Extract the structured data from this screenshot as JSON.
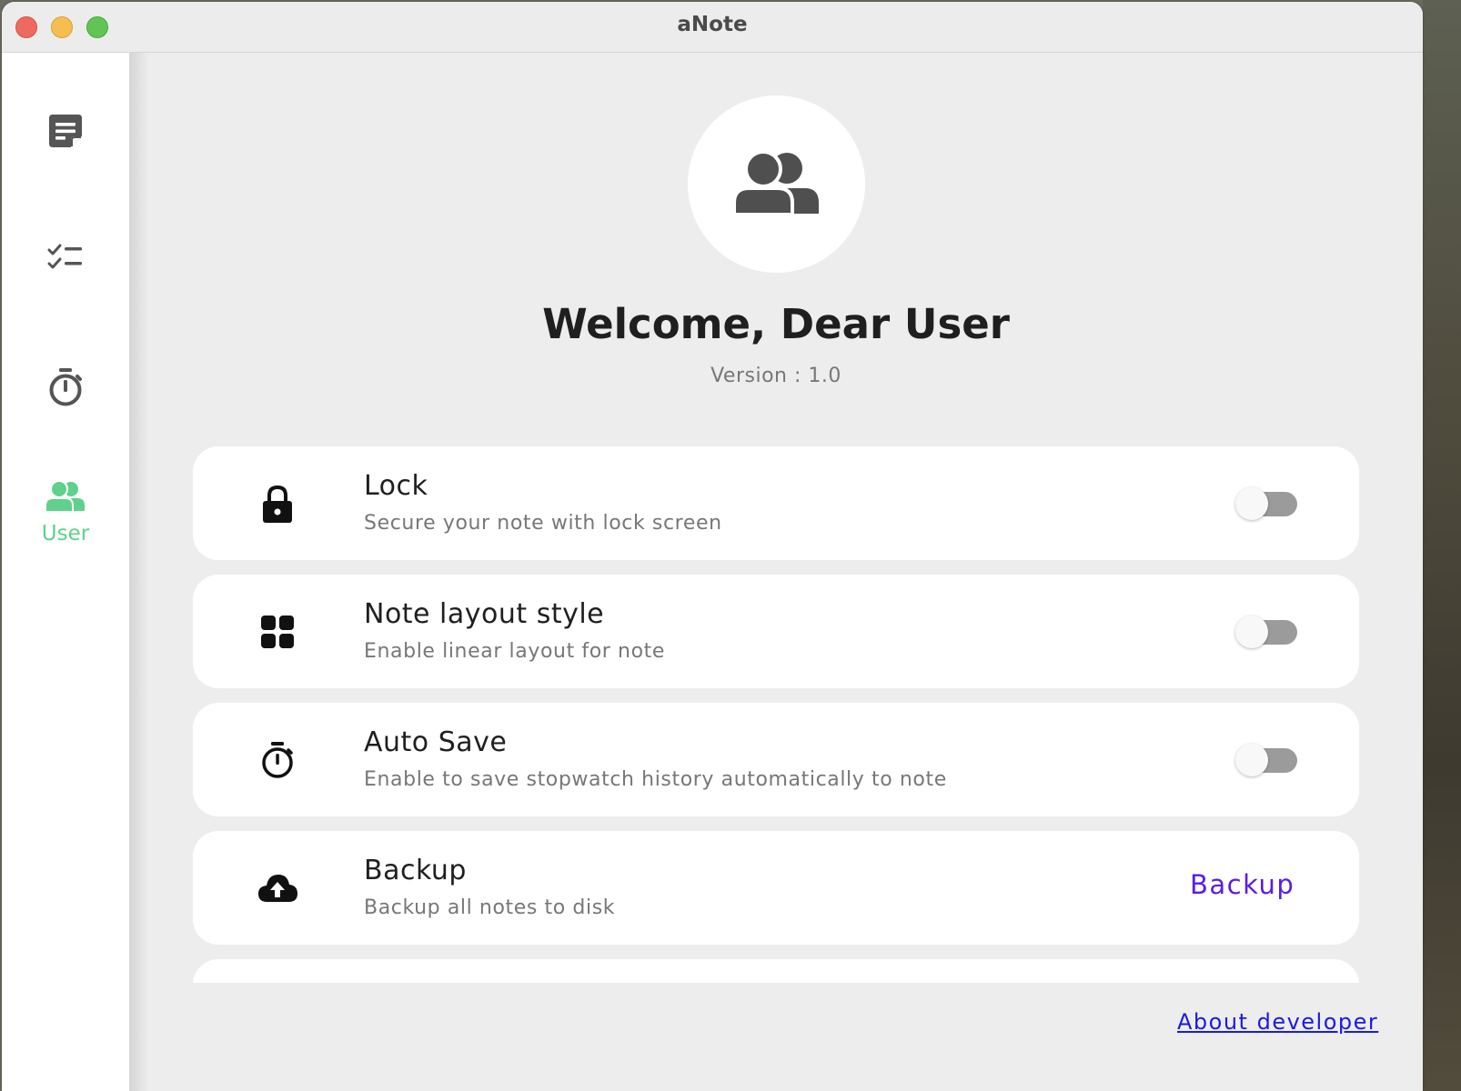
{
  "window": {
    "title": "aNote"
  },
  "sidebar": {
    "items": [
      {
        "id": "notes",
        "icon": "note-icon",
        "label": "",
        "active": false
      },
      {
        "id": "todo",
        "icon": "checklist-icon",
        "label": "",
        "active": false
      },
      {
        "id": "stopwatch",
        "icon": "timer-icon",
        "label": "",
        "active": false
      },
      {
        "id": "user",
        "icon": "users-icon",
        "label": "User",
        "active": true
      }
    ]
  },
  "profile": {
    "avatar_icon": "users-icon",
    "welcome": "Welcome, Dear User",
    "version": "Version : 1.0"
  },
  "settings": [
    {
      "icon": "lock-icon",
      "title": "Lock",
      "subtitle": "Secure your note with lock screen",
      "control": "toggle",
      "enabled": false
    },
    {
      "icon": "grid-icon",
      "title": "Note layout style",
      "subtitle": "Enable linear layout for note",
      "control": "toggle",
      "enabled": false
    },
    {
      "icon": "timer-icon",
      "title": "Auto Save",
      "subtitle": "Enable to save stopwatch history automatically to note",
      "control": "toggle",
      "enabled": false
    },
    {
      "icon": "cloud-upload-icon",
      "title": "Backup",
      "subtitle": "Backup all notes to disk",
      "control": "button",
      "button_label": "Backup"
    }
  ],
  "footer": {
    "about_link": "About developer"
  },
  "colors": {
    "accent_green": "#5fd18c",
    "button_purple": "#5b1de6",
    "link_blue": "#1a1ae6",
    "background": "#ededed",
    "card": "#ffffff",
    "toggle_track": "#9b9b9b"
  }
}
